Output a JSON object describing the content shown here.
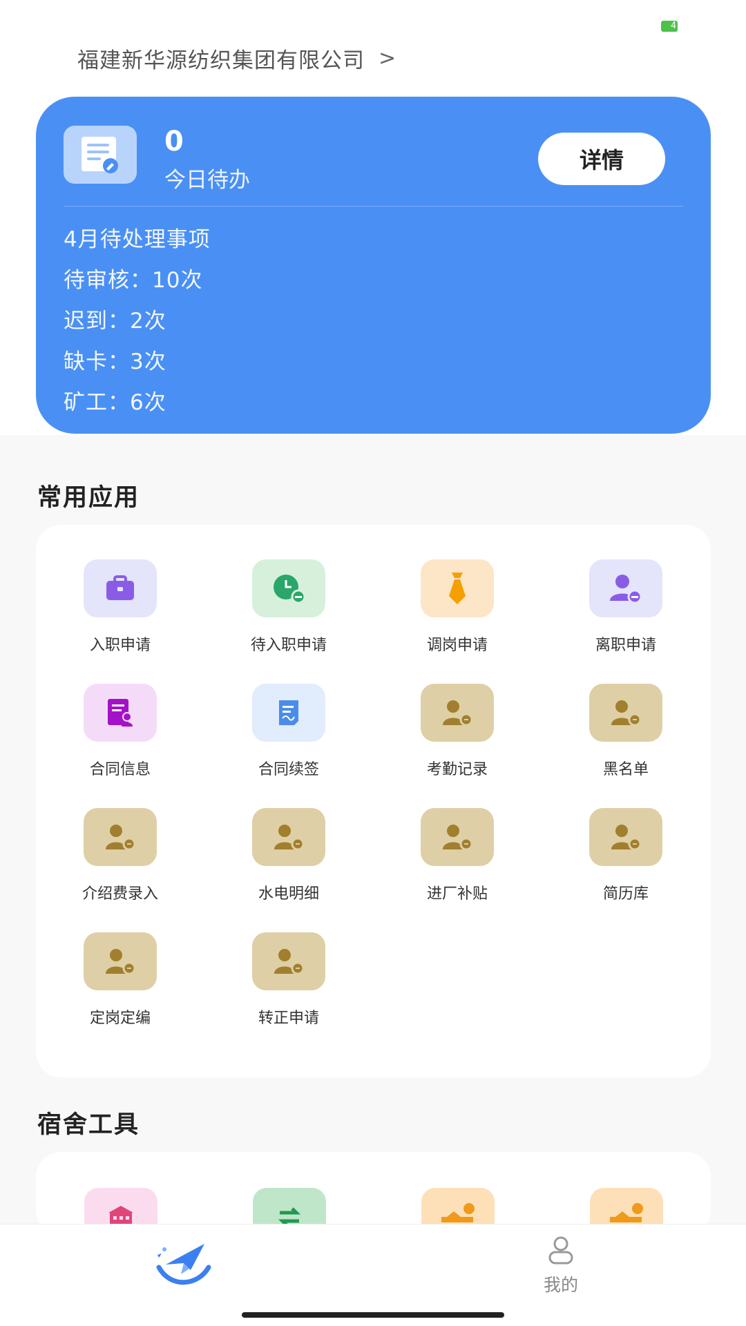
{
  "status": {
    "battery": "4"
  },
  "company": {
    "name": "福建新华源纺织集团有限公司",
    "chevron": ">"
  },
  "todo": {
    "count": "0",
    "label": "今日待办",
    "detail_button": "详情",
    "items": [
      "4月待处理事项",
      "待审核：10次",
      "迟到：2次",
      "缺卡：3次",
      "矿工：6次"
    ]
  },
  "common_apps": {
    "title": "常用应用",
    "items": [
      {
        "label": "入职申请",
        "icon": "briefcase-icon"
      },
      {
        "label": "待入职申请",
        "icon": "clock-icon"
      },
      {
        "label": "调岗申请",
        "icon": "tie-icon"
      },
      {
        "label": "离职申请",
        "icon": "user-minus-icon"
      },
      {
        "label": "合同信息",
        "icon": "contract-icon"
      },
      {
        "label": "合同续签",
        "icon": "document-sign-icon"
      },
      {
        "label": "考勤记录",
        "icon": "user-money-icon"
      },
      {
        "label": "黑名单",
        "icon": "user-money-icon"
      },
      {
        "label": "介绍费录入",
        "icon": "user-money-icon"
      },
      {
        "label": "水电明细",
        "icon": "user-money-icon"
      },
      {
        "label": "进厂补贴",
        "icon": "user-money-icon"
      },
      {
        "label": "简历库",
        "icon": "user-money-icon"
      },
      {
        "label": "定岗定编",
        "icon": "user-money-icon"
      },
      {
        "label": "转正申请",
        "icon": "user-money-icon"
      }
    ]
  },
  "dorm_tools": {
    "title": "宿舍工具",
    "icons": [
      "building-icon",
      "swap-icon",
      "bed-icon",
      "bed-icon"
    ]
  },
  "tabbar": {
    "mine_label": "我的"
  },
  "colors": {
    "accent": "#4a90f4",
    "purple_bg": "#e4e4fb",
    "green_bg": "#d6f0dc",
    "orange_bg": "#fde5c8",
    "pink_bg": "#f4dcf8",
    "blue_bg": "#e1ecfc",
    "khaki_bg": "#dfcfa6"
  }
}
